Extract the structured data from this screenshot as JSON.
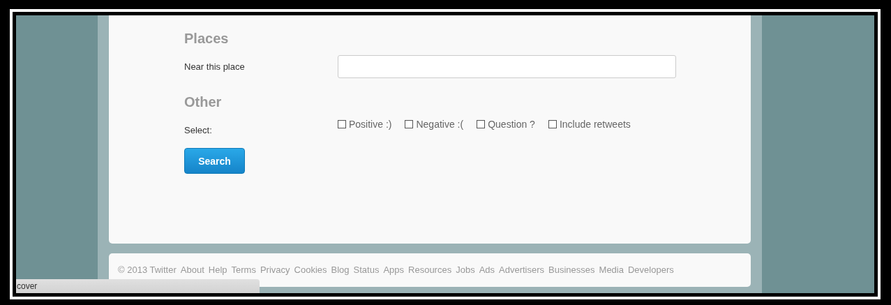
{
  "places": {
    "heading": "Places",
    "fields": [
      {
        "label": "Near this place"
      }
    ]
  },
  "other": {
    "heading": "Other",
    "label": "Select:",
    "checkboxes": [
      {
        "label": "Positive :)",
        "checked": false
      },
      {
        "label": "Negative :(",
        "checked": false
      },
      {
        "label": "Question ?",
        "checked": false
      },
      {
        "label": "Include retweets",
        "checked": false
      }
    ]
  },
  "search_button": "Search",
  "footer": {
    "copyright": "© 2013 Twitter",
    "links": [
      "About",
      "Help",
      "Terms",
      "Privacy",
      "Cookies",
      "Blog",
      "Status",
      "Apps",
      "Resources",
      "Jobs",
      "Ads",
      "Advertisers",
      "Businesses",
      "Media",
      "Developers"
    ]
  },
  "status_bar": "cover"
}
